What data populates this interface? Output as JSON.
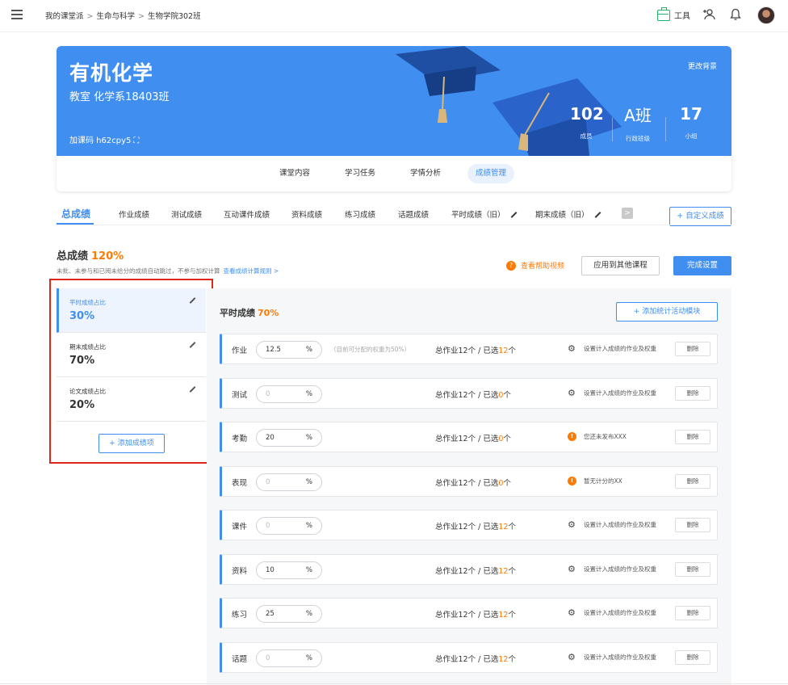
{
  "topbar": {
    "breadcrumb": [
      "我的课堂派",
      "生命与科学",
      "生物学院302班"
    ],
    "tools_label": "工具"
  },
  "course": {
    "title": "有机化学",
    "subtitle": "教室 化学系18403班",
    "join_code": "加课码 h62cpy5",
    "change_bg": "更改背景",
    "stats": [
      {
        "num": "102",
        "label": "成员"
      },
      {
        "num": "A班",
        "label": "行政班级"
      },
      {
        "num": "17",
        "label": "小组"
      }
    ],
    "tabs": [
      "课堂内容",
      "学习任务",
      "学情分析",
      "成绩管理"
    ]
  },
  "grade_tabs": [
    "总成绩",
    "作业成绩",
    "测试成绩",
    "互动课件成绩",
    "资料成绩",
    "练习成绩",
    "话题成绩",
    "平时成绩（旧）",
    "期末成绩（旧）"
  ],
  "custom_grade_label": "+ 自定义成绩",
  "total": {
    "title": "总成绩",
    "percent": "120%",
    "desc": "未批、未参与和已阅未给分的成绩自动跳过，不参与加权计算",
    "rule_link": "查看成绩计算规则 >",
    "help_video": "查看帮助视频",
    "apply_label": "应用到其他课程",
    "finish_label": "完成设置"
  },
  "left_items": [
    {
      "label": "平时成绩占比",
      "value": "30%"
    },
    {
      "label": "期末成绩占比",
      "value": "70%"
    },
    {
      "label": "论文成绩占比",
      "value": "20%"
    }
  ],
  "add_item_label": "+ 添加成绩项",
  "right": {
    "title": "平时成绩",
    "percent": "70%",
    "add_module_label": "+ 添加统计活动模块",
    "unit": "%",
    "placeholder": "0",
    "hint": "（目前可分配的权重为50%）",
    "count_prefix": "总作业12个 / 已选",
    "count_suffix": "个",
    "delete_label": "删除",
    "rows": [
      {
        "name": "作业",
        "value": "12.5",
        "selected": "12",
        "setting": "设置计入成绩的作业及权重",
        "icon": "gear-icon"
      },
      {
        "name": "测试",
        "value": "",
        "selected": "0",
        "setting": "设置计入成绩的作业及权重",
        "icon": "gear-icon"
      },
      {
        "name": "考勤",
        "value": "20",
        "selected": "0",
        "setting": "您还未发布XXX",
        "icon": "warning-icon"
      },
      {
        "name": "表现",
        "value": "",
        "selected": "0",
        "setting": "暂无计分的XX",
        "icon": "warning-icon"
      },
      {
        "name": "课件",
        "value": "",
        "selected": "12",
        "setting": "设置计入成绩的作业及权重",
        "icon": "gear-icon"
      },
      {
        "name": "资料",
        "value": "10",
        "selected": "12",
        "setting": "设置计入成绩的作业及权重",
        "icon": "gear-icon"
      },
      {
        "name": "练习",
        "value": "25",
        "selected": "12",
        "setting": "设置计入成绩的作业及权重",
        "icon": "gear-icon"
      },
      {
        "name": "话题",
        "value": "",
        "selected": "12",
        "setting": "设置计入成绩的作业及权重",
        "icon": "gear-icon"
      }
    ]
  }
}
